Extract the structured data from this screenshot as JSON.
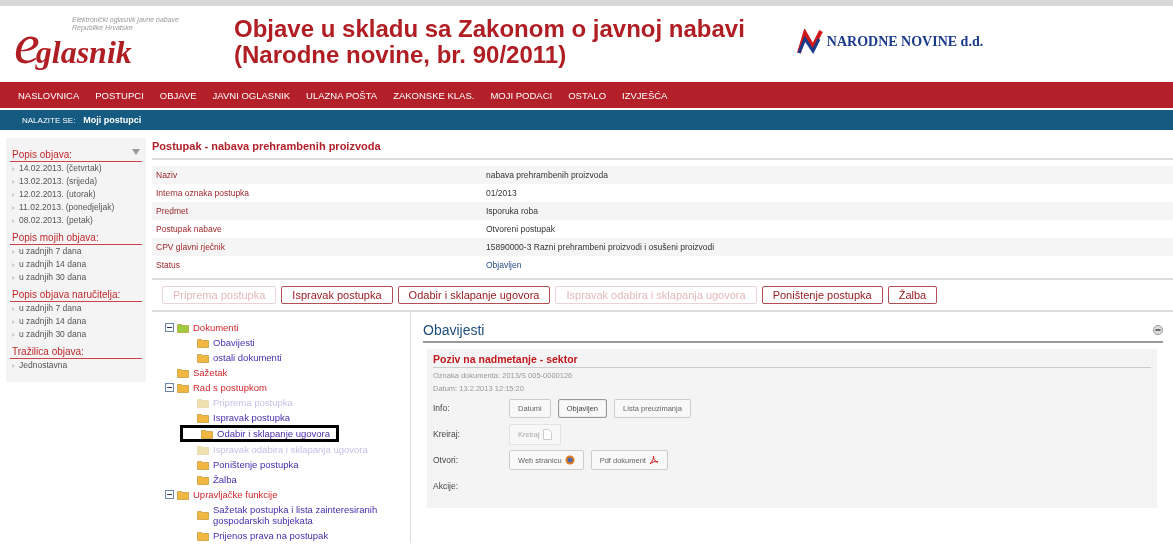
{
  "header": {
    "logo_mark": "e",
    "logo_word": "glasnik",
    "tagline": "Elektronički oglasnik javne nabave Republike Hrvatske",
    "title_lines": [
      "Objave u skladu sa Zakonom o javnoj nabavi",
      "(Narodne novine, br. 90/2011)"
    ],
    "partner": "NARODNE NOVINE d.d."
  },
  "nav": [
    "NASLOVNICA",
    "POSTUPCI",
    "OBJAVE",
    "JAVNI OGLASNIK",
    "ULAZNA POŠTA",
    "ZAKONSKE KLAS.",
    "MOJI PODACI",
    "OSTALO",
    "IZVJEŠĆA"
  ],
  "breadcrumb": {
    "label": "NALAZITE SE:",
    "current": "Moji postupci"
  },
  "sidebar": {
    "sections": [
      {
        "title": "Popis objava:",
        "collapse": true,
        "items": [
          "14.02.2013. (četvrtak)",
          "13.02.2013. (srijeda)",
          "12.02.2013. (utorak)",
          "11.02.2013. (ponedjeljak)",
          "08.02.2013. (petak)"
        ]
      },
      {
        "title": "Popis mojih objava:",
        "items": [
          "u zadnjih 7 dana",
          "u zadnjih 14 dana",
          "u zadnjih 30 dana"
        ]
      },
      {
        "title": "Popis objava naručitelja:",
        "items": [
          "u zadnjih 7 dana",
          "u zadnjih 14 dana",
          "u zadnjih 30 dana"
        ]
      },
      {
        "title": "Tražilica objava:",
        "items": [
          "Jednostavna"
        ]
      }
    ]
  },
  "procedure": {
    "title": "Postupak - nabava prehrambenih proizvoda",
    "fields": [
      {
        "label": "Naziv",
        "value": "nabava prehrambenih proizvoda",
        "kind": "text"
      },
      {
        "label": "Interna oznaka postupka",
        "value": "01/2013",
        "kind": "text"
      },
      {
        "label": "Predmet",
        "value": "Isporuka roba",
        "kind": "text"
      },
      {
        "label": "Postupak nabave",
        "value": "Otvoreni postupak",
        "kind": "text"
      },
      {
        "label": "CPV glavni rječnik",
        "value": "15890000-3 Razni prehrambeni proizvodi i osušeni proizvodi",
        "kind": "text"
      },
      {
        "label": "Status",
        "value": "Objavljen",
        "kind": "status"
      }
    ],
    "actions": [
      {
        "label": "Priprema postupka",
        "disabled": true
      },
      {
        "label": "Ispravak postupka",
        "disabled": false
      },
      {
        "label": "Odabir i sklapanje ugovora",
        "disabled": false
      },
      {
        "label": "Ispravak odabira i sklapanja ugovora",
        "disabled": true
      },
      {
        "label": "Poništenje postupka",
        "disabled": false
      },
      {
        "label": "Žalba",
        "disabled": false
      }
    ]
  },
  "tree": [
    {
      "label": "Dokumenti",
      "expanded": true,
      "disabled": false,
      "selected": false,
      "children": [
        {
          "label": "Obavijesti",
          "disabled": false,
          "selected": false
        },
        {
          "label": "ostali dokumenti",
          "disabled": false,
          "selected": false
        }
      ]
    },
    {
      "label": "Sažetak",
      "disabled": false,
      "selected": false
    },
    {
      "label": "Rad s postupkom",
      "expanded": true,
      "disabled": false,
      "selected": false,
      "children": [
        {
          "label": "Priprema postupka",
          "disabled": true,
          "selected": false
        },
        {
          "label": "Ispravak postupka",
          "disabled": false,
          "selected": false
        },
        {
          "label": "Odabir i sklapanje ugovora",
          "disabled": false,
          "selected": true
        },
        {
          "label": "Ispravak odabira i sklapanja ugovora",
          "disabled": true,
          "selected": false
        },
        {
          "label": "Poništenje postupka",
          "disabled": false,
          "selected": false
        },
        {
          "label": "Žalba",
          "disabled": false,
          "selected": false
        }
      ]
    },
    {
      "label": "Upravljačke funkcije",
      "expanded": true,
      "disabled": false,
      "selected": false,
      "children": [
        {
          "label": "Sažetak postupka i lista zainteresiranih gospodarskih subjekata",
          "disabled": false,
          "selected": false
        },
        {
          "label": "Prijenos prava na postupak",
          "disabled": false,
          "selected": false
        }
      ]
    }
  ],
  "notices": {
    "title": "Obavijesti",
    "doc_title": "Poziv na nadmetanje - sektor",
    "meta": [
      "Oznaka dokumenta: 2013/S 005-0000126",
      "Datum: 13.2.2013 12:15:20"
    ],
    "rows": [
      {
        "label": "Info:",
        "buttons": [
          {
            "label": "Datumi",
            "disabled": false,
            "pressed": false
          },
          {
            "label": "Objavljen",
            "disabled": false,
            "pressed": true
          },
          {
            "label": "Lista preuzimanja",
            "disabled": false,
            "pressed": false
          }
        ]
      },
      {
        "label": "Kreiraj:",
        "buttons": [
          {
            "label": "Kreiraj",
            "disabled": true,
            "pressed": false,
            "kind": "document"
          }
        ]
      },
      {
        "label": "Otvori:",
        "buttons": [
          {
            "label": "Web stranicu",
            "disabled": false,
            "pressed": false,
            "kind": "globe"
          },
          {
            "label": "Pdf dokument",
            "disabled": false,
            "pressed": false,
            "kind": "pdf"
          }
        ]
      },
      {
        "label": "Akcije:",
        "buttons": []
      }
    ]
  }
}
